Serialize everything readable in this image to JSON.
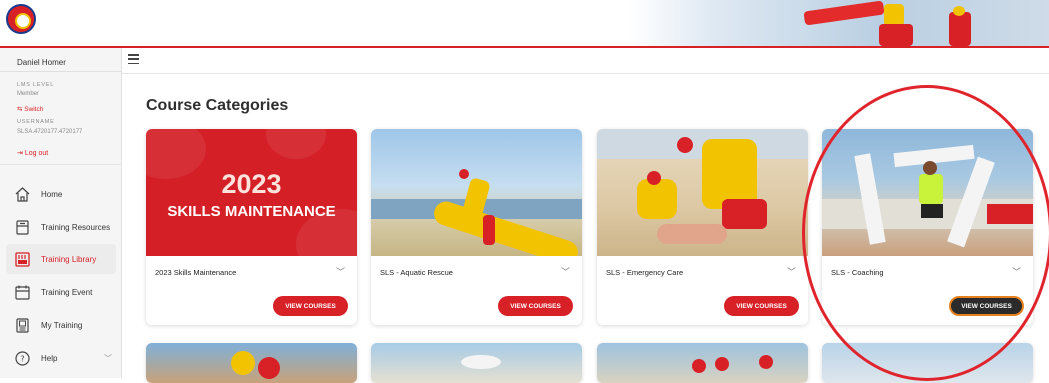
{
  "sidebar": {
    "user_name": "Daniel Homer",
    "lms_level_label": "LMS LEVEL",
    "lms_level_value": "Member",
    "switch_label": "Switch",
    "username_label": "USERNAME",
    "username_value": "SLSA.4720177.4720177",
    "logout_label": "Log out",
    "items": [
      {
        "label": "Home"
      },
      {
        "label": "Training Resources"
      },
      {
        "label": "Training Library"
      },
      {
        "label": "Training Event"
      },
      {
        "label": "My Training"
      },
      {
        "label": "Help"
      }
    ]
  },
  "main": {
    "page_title": "Course Categories",
    "cards": [
      {
        "image_line1": "2023",
        "image_line2": "SKILLS MAINTENANCE",
        "title": "2023 Skills Maintenance",
        "button": "VIEW COURSES"
      },
      {
        "title": "SLS - Aquatic Rescue",
        "button": "VIEW COURSES"
      },
      {
        "title": "SLS - Emergency Care",
        "button": "VIEW COURSES"
      },
      {
        "title": "SLS - Coaching",
        "button": "VIEW COURSES"
      }
    ]
  },
  "colors": {
    "brand_red": "#d82027",
    "highlight": "#e0242c",
    "dark_button": "#2b2b2b"
  }
}
